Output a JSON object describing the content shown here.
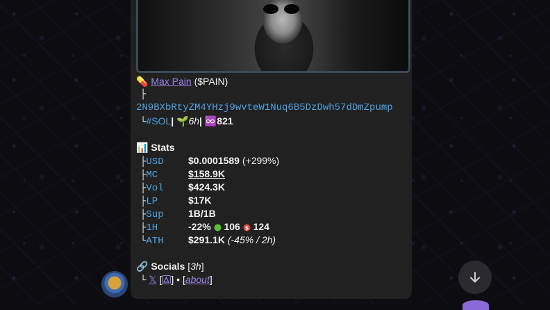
{
  "token": {
    "emoji": "💊",
    "name": "Max Pain",
    "ticker": "($PAIN)",
    "tree_branch": "├",
    "address": "2N9BXbRtyZM4YHzj9wvteW1Nuq6B5DzDwh57dDmZpump",
    "chain_branch": "└",
    "chain": "#SOL",
    "sep": "|",
    "age_icon": "🌱",
    "age": "6h",
    "holders_icon": "♾️",
    "holders": "821"
  },
  "stats": {
    "icon": "📊",
    "title": "Stats",
    "rows": [
      {
        "branch": "├",
        "key": "USD",
        "value": "$0.0001589",
        "extra": "(+299%)"
      },
      {
        "branch": "├",
        "key": "MC",
        "value": "$158.9K"
      },
      {
        "branch": "├",
        "key": "Vol",
        "value": "$424.3K"
      },
      {
        "branch": "├",
        "key": "LP",
        "value": "$17K"
      },
      {
        "branch": "├",
        "key": "Sup",
        "value": "1B/1B"
      },
      {
        "branch": "├",
        "key": "1H",
        "value": "-22%",
        "buys": "106",
        "sells": "124"
      },
      {
        "branch": "└",
        "key": "ATH",
        "value": "$291.1K",
        "extra": "(-45% / 2h)"
      }
    ]
  },
  "socials": {
    "icon": "🔗",
    "title": "Socials",
    "age_open": "[",
    "age": "3h",
    "age_close": "]",
    "branch": "└",
    "x_label": "𝕏",
    "bracket_open": "[",
    "bracket_close": "]",
    "bullet": "•",
    "about": "about"
  },
  "colors": {
    "link": "#9b84e8",
    "mono_blue": "#4fa3e0",
    "bubble": "#212121"
  }
}
